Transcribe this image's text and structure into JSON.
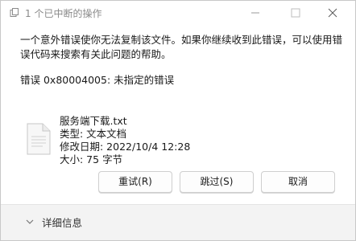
{
  "dialog": {
    "title": "1 个已中断的操作",
    "message": "一个意外错误使你无法复制该文件。如果你继续收到此错误，可以使用错误代码来搜索有关此问题的帮助。",
    "error": "错误 0x80004005: 未指定的错误",
    "file": {
      "name": "服务端下载.txt",
      "type": "类型: 文本文档",
      "modified": "修改日期: 2022/10/4 12:28",
      "size": "大小: 75 字节"
    },
    "buttons": {
      "retry": "重试(R)",
      "skip": "跳过(S)",
      "cancel": "取消"
    },
    "details_label": "详细信息"
  },
  "icons": {
    "title": "copy-icon",
    "file": "text-file-icon",
    "minimize": "minimize-icon",
    "maximize": "maximize-icon",
    "close": "close-icon",
    "details": "chevron-down-icon"
  }
}
